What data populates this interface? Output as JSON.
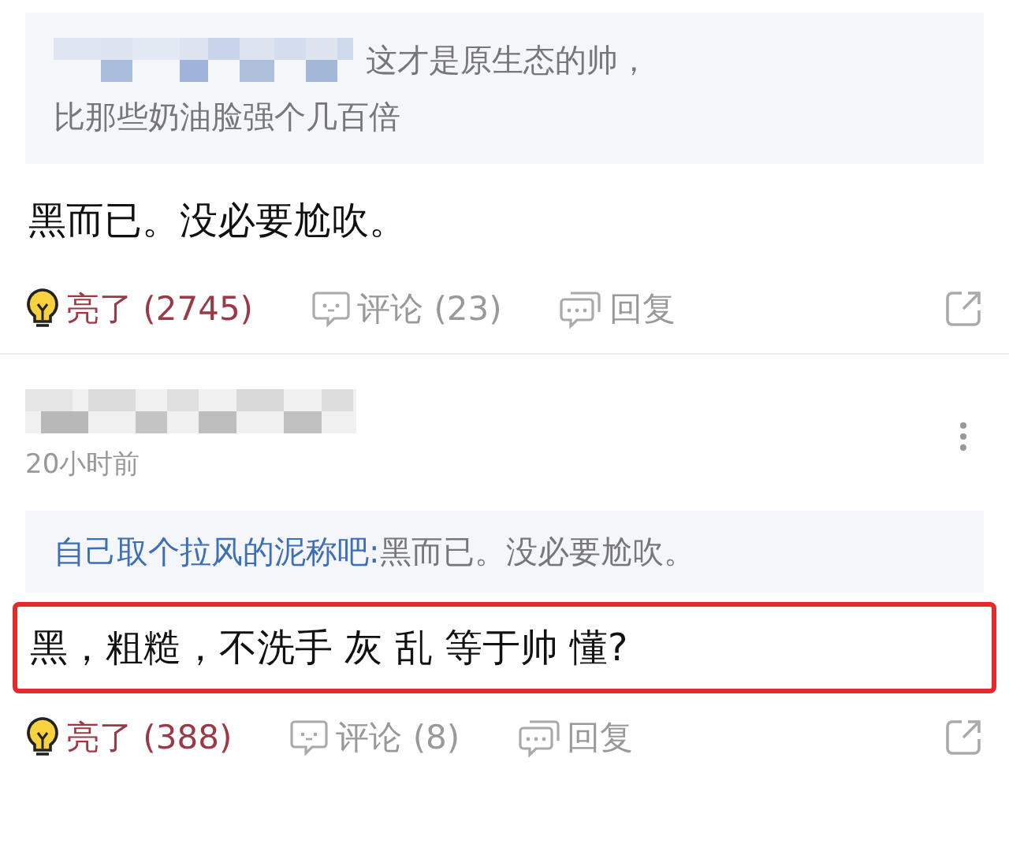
{
  "comments": [
    {
      "quote": {
        "author": {
          "kind": "blurred"
        },
        "lines": [
          "这才是原生态的帅，",
          "比那些奶油脸强个几百倍"
        ]
      },
      "text": "黑而已。没必要尬吹。",
      "highlighted": false,
      "actions": {
        "like_label": "亮了",
        "like_count": "(2745)",
        "liked": true,
        "comment_label": "评论",
        "comment_count": "(23)",
        "reply_label": "回复"
      }
    },
    {
      "author": {
        "kind": "blurred"
      },
      "time": "20小时前",
      "quote": {
        "author": {
          "kind": "named",
          "name": "自己取个拉风的泥称吧:"
        },
        "lines": [
          "黑而已。没必要尬吹。"
        ]
      },
      "text": "黑，粗糙，不洗手  灰  乱  等于帅 懂?",
      "highlighted": true,
      "actions": {
        "like_label": "亮了",
        "like_count": "(388)",
        "liked": true,
        "comment_label": "评论",
        "comment_count": "(8)",
        "reply_label": "回复"
      }
    }
  ]
}
